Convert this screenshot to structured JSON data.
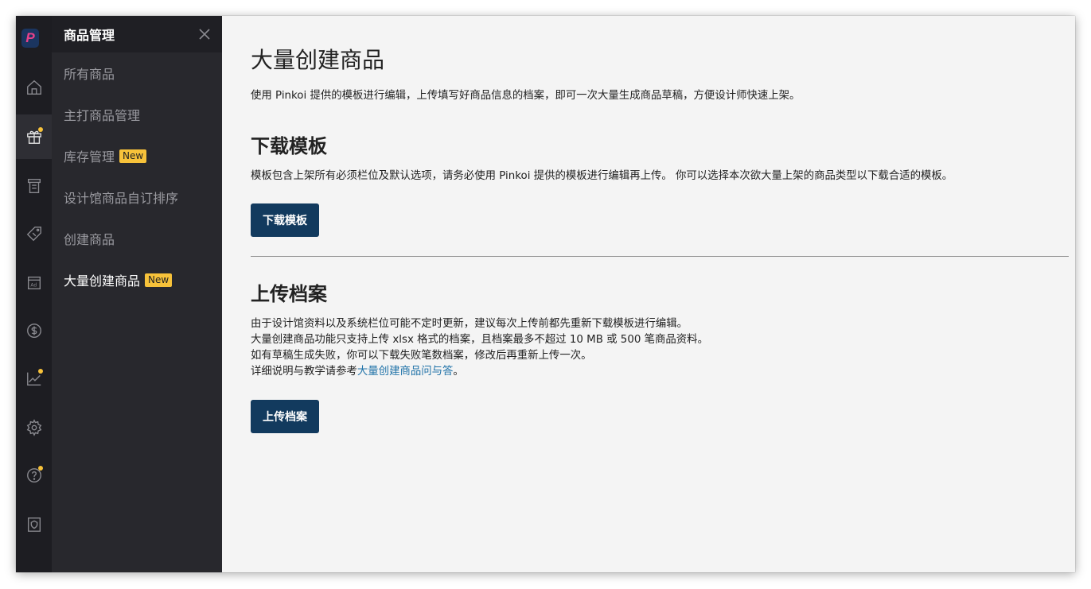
{
  "rail": {
    "items": [
      {
        "name": "home-icon",
        "active": false,
        "dot": false
      },
      {
        "name": "gift-icon",
        "active": true,
        "dot": true
      },
      {
        "name": "orders-icon",
        "active": false,
        "dot": false
      },
      {
        "name": "price-tag-icon",
        "active": false,
        "dot": false
      },
      {
        "name": "ad-icon",
        "active": false,
        "dot": false
      },
      {
        "name": "dollar-icon",
        "active": false,
        "dot": false
      },
      {
        "name": "chart-icon",
        "active": false,
        "dot": true
      },
      {
        "name": "gear-icon",
        "active": false,
        "dot": false
      },
      {
        "name": "help-icon",
        "active": false,
        "dot": true
      },
      {
        "name": "shield-icon",
        "active": false,
        "dot": false
      }
    ],
    "logo_letter": "P",
    "colors": {
      "dot": "#f7c23a",
      "logo_bg": "#1b3560",
      "logo_letter": "#e8418a"
    }
  },
  "submenu": {
    "title": "商品管理",
    "items": [
      {
        "label": "所有商品",
        "badge": ""
      },
      {
        "label": "主打商品管理",
        "badge": ""
      },
      {
        "label": "库存管理",
        "badge": "New"
      },
      {
        "label": "设计馆商品自订排序",
        "badge": ""
      },
      {
        "label": "创建商品",
        "badge": ""
      },
      {
        "label": "大量创建商品",
        "badge": "New"
      }
    ]
  },
  "main": {
    "title": "大量创建商品",
    "intro": "使用 Pinkoi 提供的模板进行编辑，上传填写好商品信息的档案，即可一次大量生成商品草稿，方便设计师快速上架。",
    "download": {
      "heading": "下载模板",
      "desc": "模板包含上架所有必须栏位及默认选项，请务必使用 Pinkoi 提供的模板进行编辑再上传。 你可以选择本次欲大量上架的商品类型以下载合适的模板。",
      "button": "下载模板"
    },
    "upload": {
      "heading": "上传档案",
      "line1": "由于设计馆资料以及系统栏位可能不定时更新，建议每次上传前都先重新下载模板进行编辑。",
      "line2": "大量创建商品功能只支持上传 xlsx 格式的档案，且档案最多不超过 10 MB 或 500 笔商品资料。",
      "line3": "如有草稿生成失败，你可以下载失败笔数档案，修改后再重新上传一次。",
      "line4_prefix": "详细说明与教学请参考",
      "line4_link": "大量创建商品问与答",
      "line4_suffix": "。",
      "button": "上传档案"
    },
    "colors": {
      "button": "#123a5e",
      "link": "#1f72a8",
      "badge": "#f7c23a"
    }
  }
}
